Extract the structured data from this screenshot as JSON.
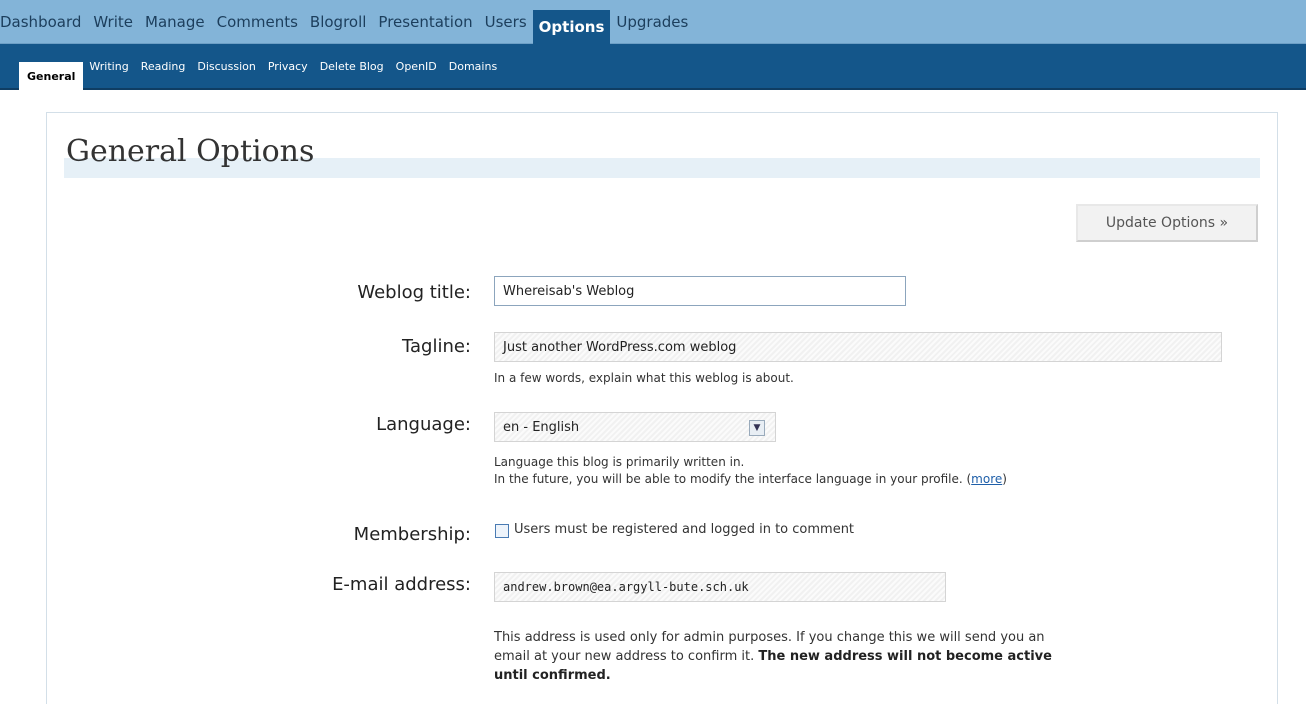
{
  "topnav": {
    "items": [
      "Dashboard",
      "Write",
      "Manage",
      "Comments",
      "Blogroll",
      "Presentation",
      "Users",
      "Options",
      "Upgrades"
    ],
    "active": "Options"
  },
  "subnav": {
    "items": [
      "General",
      "Writing",
      "Reading",
      "Discussion",
      "Privacy",
      "Delete Blog",
      "OpenID",
      "Domains"
    ],
    "active": "General"
  },
  "page": {
    "title": "General Options",
    "update_button": "Update Options »"
  },
  "form": {
    "weblog_title": {
      "label": "Weblog title:",
      "value": "Whereisab's Weblog"
    },
    "tagline": {
      "label": "Tagline:",
      "value": "Just another WordPress.com weblog",
      "hint": "In a few words, explain what this weblog is about."
    },
    "language": {
      "label": "Language:",
      "value": "en - English",
      "hint1": "Language this blog is primarily written in.",
      "hint2_prefix": "In the future, you will be able to modify the interface language in your profile. (",
      "hint2_link": "more",
      "hint2_suffix": ")"
    },
    "membership": {
      "label": "Membership:",
      "checkbox_label": "Users must be registered and logged in to comment",
      "checked": false
    },
    "email": {
      "label": "E-mail address:",
      "value": "andrew.brown@ea.argyll-bute.sch.uk",
      "hint_line1": "This address is used only for admin purposes. If you change this we will send you an",
      "hint_line2_prefix": "email at your new address to confirm it. ",
      "hint_line2_bold": "The new address will not become active",
      "hint_line3_bold": "until confirmed."
    }
  }
}
